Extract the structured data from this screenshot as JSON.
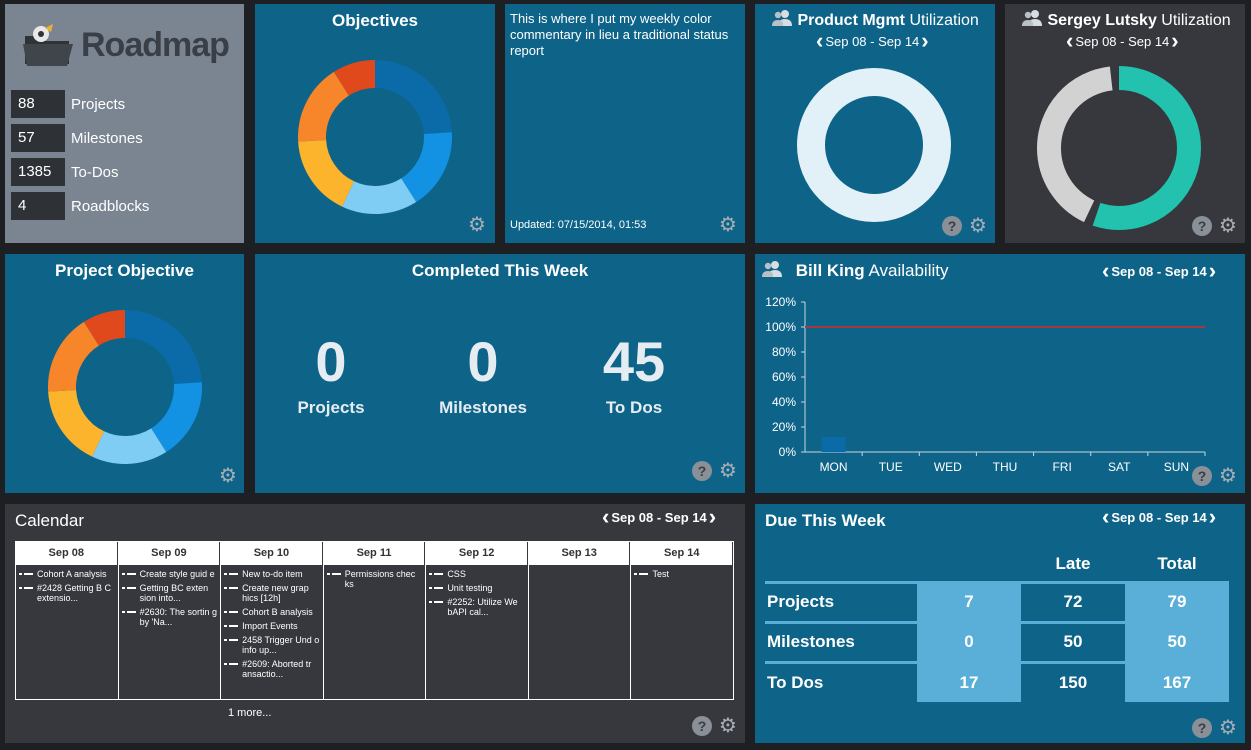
{
  "roadmap": {
    "logo_text": "Roadmap",
    "stats": [
      {
        "value": "88",
        "label": "Projects"
      },
      {
        "value": "57",
        "label": "Milestones"
      },
      {
        "value": "1385",
        "label": "To-Dos"
      },
      {
        "value": "4",
        "label": "Roadblocks"
      }
    ]
  },
  "objectives": {
    "title": "Objectives",
    "donut": [
      {
        "value": 24,
        "color": "#0b6aa8"
      },
      {
        "value": 17,
        "color": "#1391e3"
      },
      {
        "value": 16,
        "color": "#7fcdf5"
      },
      {
        "value": 17,
        "color": "#fbb42c"
      },
      {
        "value": 17,
        "color": "#f7862a"
      },
      {
        "value": 9,
        "color": "#e0491c"
      }
    ]
  },
  "commentary": {
    "text": "This is where I put my weekly color commentary in lieu a traditional status report",
    "updated": "Updated: 07/15/2014, 01:53"
  },
  "pm_util": {
    "name": "Product Mgmt",
    "suffix": "Utilization",
    "week": "Sep 08 - Sep 14",
    "donut": [
      {
        "value": 100,
        "color": "#e2f1f7"
      }
    ]
  },
  "sergey_util": {
    "name": "Sergey Lutsky",
    "suffix": "Utilization",
    "week": "Sep 08 - Sep 14",
    "donut": [
      {
        "value": 57,
        "color": "#22c2ae"
      },
      {
        "value": 43,
        "color": "#d2d2d2"
      }
    ]
  },
  "project_objective": {
    "title": "Project Objective",
    "donut": [
      {
        "value": 24,
        "color": "#0b6aa8"
      },
      {
        "value": 17,
        "color": "#1391e3"
      },
      {
        "value": 16,
        "color": "#7fcdf5"
      },
      {
        "value": 17,
        "color": "#fbb42c"
      },
      {
        "value": 17,
        "color": "#f7862a"
      },
      {
        "value": 9,
        "color": "#e0491c"
      }
    ]
  },
  "completed": {
    "title": "Completed This Week",
    "items": [
      {
        "value": "0",
        "label": "Projects"
      },
      {
        "value": "0",
        "label": "Milestones"
      },
      {
        "value": "45",
        "label": "To Dos"
      }
    ]
  },
  "availability": {
    "name": "Bill King",
    "suffix": "Availability",
    "week": "Sep 08 - Sep 14"
  },
  "chart_data": {
    "type": "bar",
    "categories": [
      "MON",
      "TUE",
      "WED",
      "THU",
      "FRI",
      "SAT",
      "SUN"
    ],
    "values": [
      12,
      0,
      0,
      0,
      0,
      0,
      0
    ],
    "yticks": [
      "0%",
      "20%",
      "40%",
      "60%",
      "80%",
      "100%",
      "120%"
    ],
    "ylim": [
      0,
      120
    ],
    "reference_line": 100,
    "bar_color": "#0b6aa8",
    "line_color": "#a23a3a"
  },
  "calendar": {
    "title": "Calendar",
    "week": "Sep 08 - Sep 14",
    "more": "1 more...",
    "days": [
      {
        "label": "Sep 08",
        "items": [
          "Cohort A analysis",
          "#2428 Getting B C extensio..."
        ]
      },
      {
        "label": "Sep 09",
        "items": [
          "Create style guid e",
          "Getting BC exten sion into...",
          "#2630: The sortin g by 'Na..."
        ]
      },
      {
        "label": "Sep 10",
        "items": [
          "New to-do item",
          "Create new grap hics [12h]",
          "Cohort B analysis",
          "Import Events",
          "2458 Trigger Und o info up...",
          "#2609: Aborted tr ansactio..."
        ]
      },
      {
        "label": "Sep 11",
        "items": [
          "Permissions chec ks"
        ]
      },
      {
        "label": "Sep 12",
        "items": [
          "CSS",
          "Unit testing",
          "#2252: Utilize We bAPI cal..."
        ]
      },
      {
        "label": "Sep 13",
        "items": []
      },
      {
        "label": "Sep 14",
        "items": [
          "Test"
        ]
      }
    ]
  },
  "due": {
    "title": "Due This Week",
    "week": "Sep 08 - Sep 14",
    "headers": [
      "Late",
      "Total"
    ],
    "rows": [
      {
        "label": "Projects",
        "a": "7",
        "late": "72",
        "total": "79"
      },
      {
        "label": "Milestones",
        "a": "0",
        "late": "50",
        "total": "50"
      },
      {
        "label": "To Dos",
        "a": "17",
        "late": "150",
        "total": "167"
      }
    ]
  }
}
